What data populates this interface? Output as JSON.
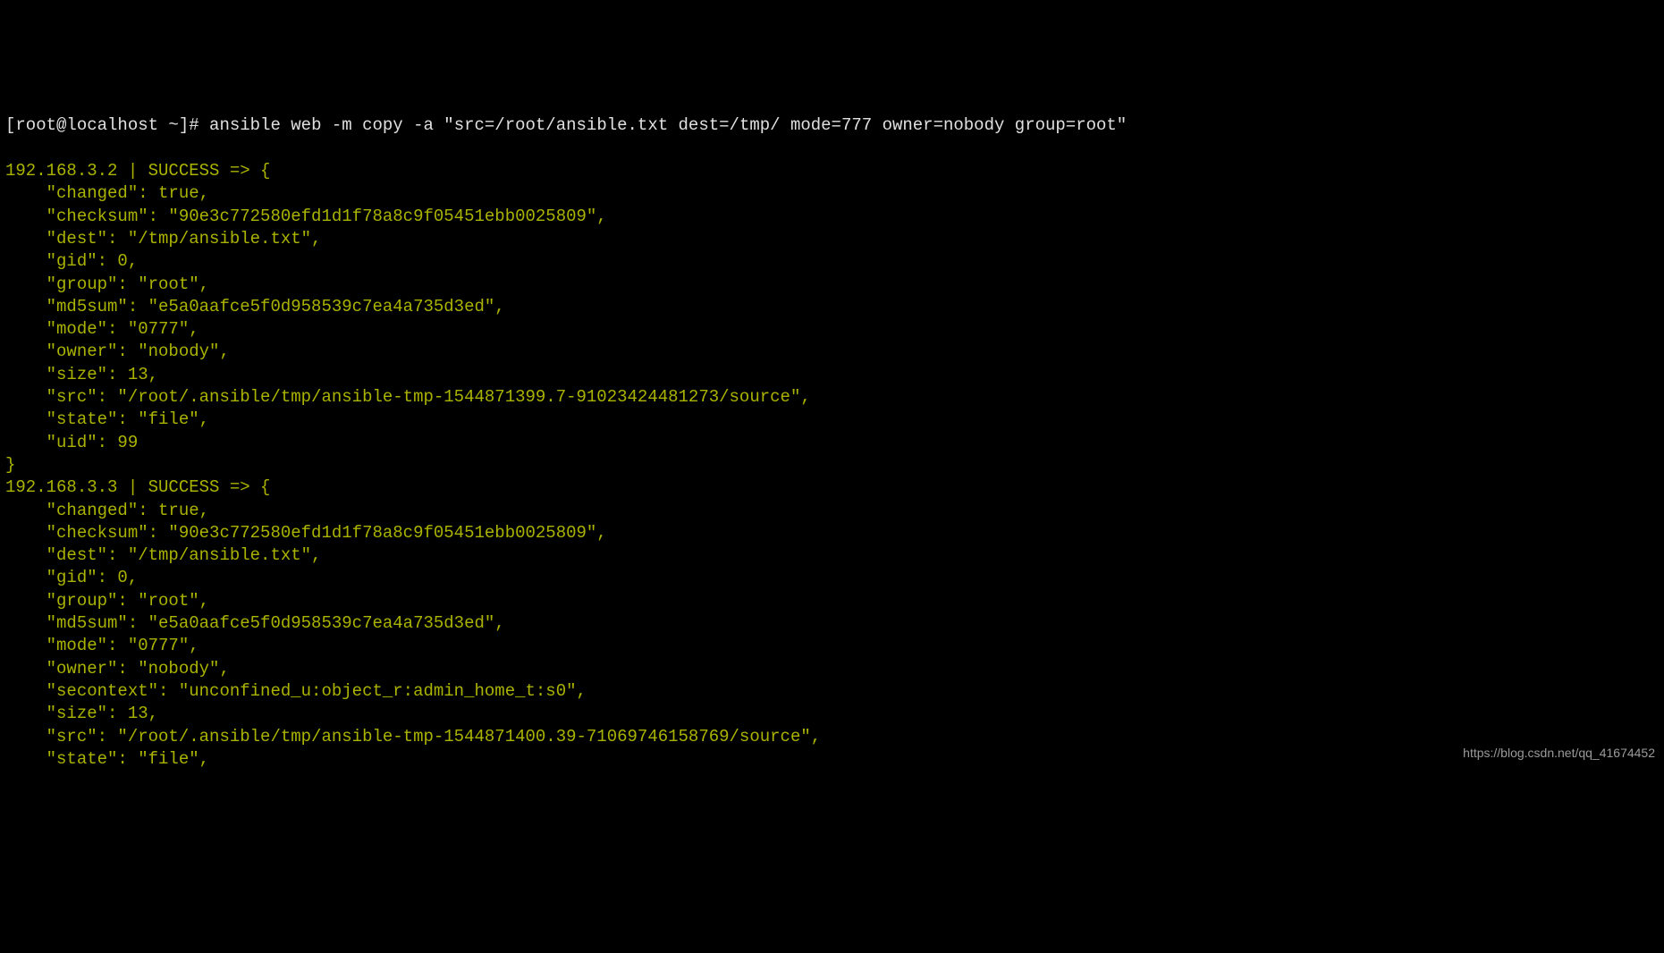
{
  "prompt": "[root@localhost ~]# ",
  "command": "ansible web -m copy -a \"src=/root/ansible.txt dest=/tmp/ mode=777 owner=nobody group=root\"",
  "hosts": [
    {
      "header": "192.168.3.2 | SUCCESS => {",
      "lines": [
        "    \"changed\": true,",
        "    \"checksum\": \"90e3c772580efd1d1f78a8c9f05451ebb0025809\",",
        "    \"dest\": \"/tmp/ansible.txt\",",
        "    \"gid\": 0,",
        "    \"group\": \"root\",",
        "    \"md5sum\": \"e5a0aafce5f0d958539c7ea4a735d3ed\",",
        "    \"mode\": \"0777\",",
        "    \"owner\": \"nobody\",",
        "    \"size\": 13,",
        "    \"src\": \"/root/.ansible/tmp/ansible-tmp-1544871399.7-91023424481273/source\",",
        "    \"state\": \"file\",",
        "    \"uid\": 99"
      ],
      "closer": "}"
    },
    {
      "header": "192.168.3.3 | SUCCESS => {",
      "lines": [
        "    \"changed\": true,",
        "    \"checksum\": \"90e3c772580efd1d1f78a8c9f05451ebb0025809\",",
        "    \"dest\": \"/tmp/ansible.txt\",",
        "    \"gid\": 0,",
        "    \"group\": \"root\",",
        "    \"md5sum\": \"e5a0aafce5f0d958539c7ea4a735d3ed\",",
        "    \"mode\": \"0777\",",
        "    \"owner\": \"nobody\",",
        "    \"secontext\": \"unconfined_u:object_r:admin_home_t:s0\",",
        "    \"size\": 13,",
        "    \"src\": \"/root/.ansible/tmp/ansible-tmp-1544871400.39-71069746158769/source\",",
        "    \"state\": \"file\","
      ],
      "closer": ""
    }
  ],
  "watermark": "https://blog.csdn.net/qq_41674452"
}
